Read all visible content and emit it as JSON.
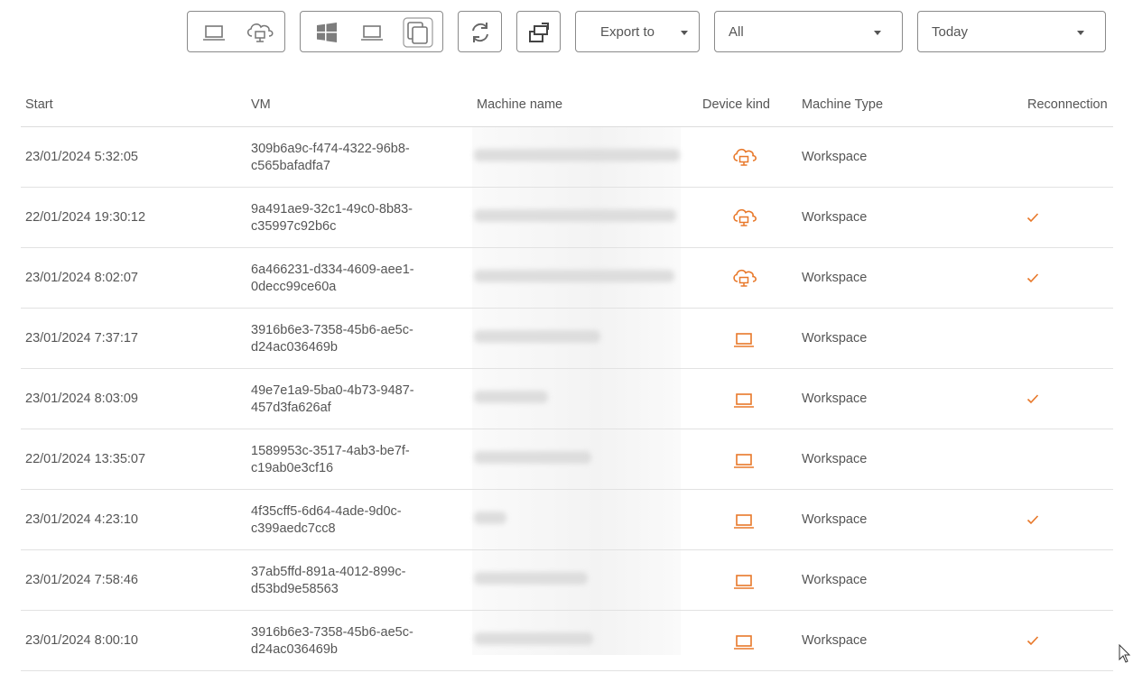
{
  "toolbar": {
    "export_label": "Export to",
    "filter_value": "All",
    "range_value": "Today"
  },
  "columns": {
    "start": "Start",
    "vm": "VM",
    "machine_name": "Machine name",
    "device_kind": "Device kind",
    "machine_type": "Machine Type",
    "reconnection": "Reconnection"
  },
  "colors": {
    "accent": "#e8782a",
    "border": "#8a8a8a",
    "text": "#555555"
  },
  "rows": [
    {
      "start": "23/01/2024 5:32:05",
      "vm_line1": "309b6a9c-f474-4322-96b8-",
      "vm_line2": "c565bafadfa7",
      "device": "cloud-desktop-icon",
      "type": "Workspace",
      "reconnection": false
    },
    {
      "start": "22/01/2024 19:30:12",
      "vm_line1": "9a491ae9-32c1-49c0-8b83-",
      "vm_line2": "c35997c92b6c",
      "device": "cloud-desktop-icon",
      "type": "Workspace",
      "reconnection": true
    },
    {
      "start": "23/01/2024 8:02:07",
      "vm_line1": "6a466231-d334-4609-aee1-",
      "vm_line2": "0decc99ce60a",
      "device": "cloud-desktop-icon",
      "type": "Workspace",
      "reconnection": true
    },
    {
      "start": "23/01/2024 7:37:17",
      "vm_line1": "3916b6e3-7358-45b6-ae5c-",
      "vm_line2": "d24ac036469b",
      "device": "laptop-icon",
      "type": "Workspace",
      "reconnection": false
    },
    {
      "start": "23/01/2024 8:03:09",
      "vm_line1": "49e7e1a9-5ba0-4b73-9487-",
      "vm_line2": "457d3fa626af",
      "device": "laptop-icon",
      "type": "Workspace",
      "reconnection": true
    },
    {
      "start": "22/01/2024 13:35:07",
      "vm_line1": "1589953c-3517-4ab3-be7f-",
      "vm_line2": "c19ab0e3cf16",
      "device": "laptop-icon",
      "type": "Workspace",
      "reconnection": false
    },
    {
      "start": "23/01/2024 4:23:10",
      "vm_line1": "4f35cff5-6d64-4ade-9d0c-",
      "vm_line2": "c399aedc7cc8",
      "device": "laptop-icon",
      "type": "Workspace",
      "reconnection": true
    },
    {
      "start": "23/01/2024 7:58:46",
      "vm_line1": "37ab5ffd-891a-4012-899c-",
      "vm_line2": "d53bd9e58563",
      "device": "laptop-icon",
      "type": "Workspace",
      "reconnection": false
    },
    {
      "start": "23/01/2024 8:00:10",
      "vm_line1": "3916b6e3-7358-45b6-ae5c-",
      "vm_line2": "d24ac036469b",
      "device": "laptop-icon",
      "type": "Workspace",
      "reconnection": true
    }
  ]
}
